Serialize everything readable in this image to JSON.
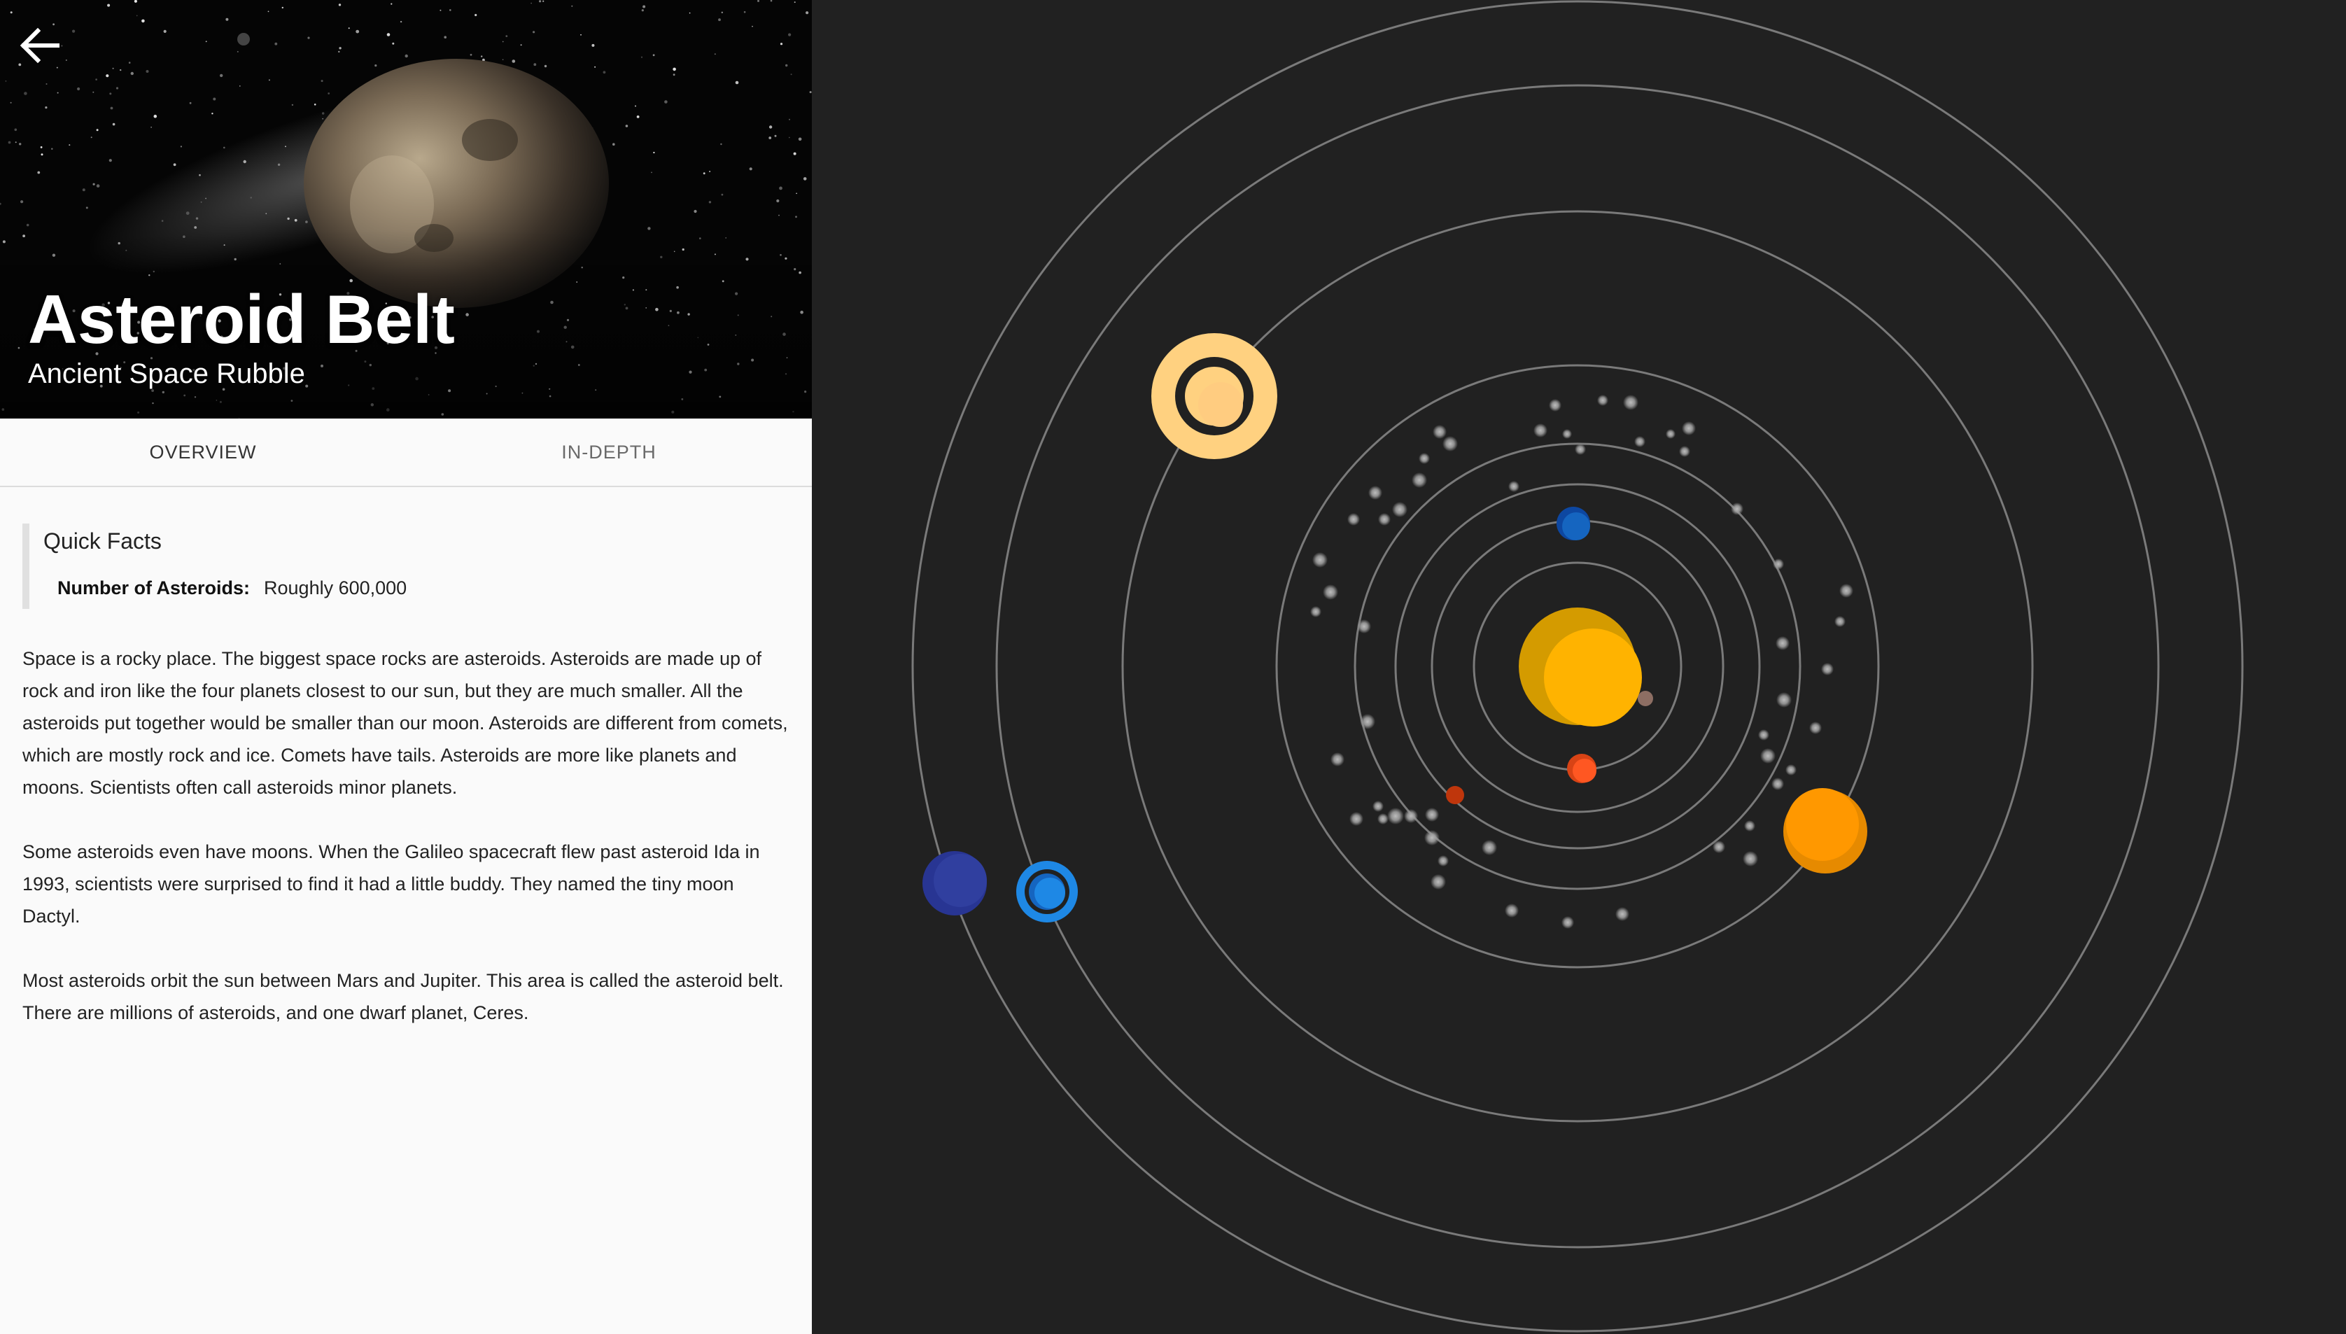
{
  "header": {
    "title": "Asteroid Belt",
    "subtitle": "Ancient Space Rubble",
    "back_icon": "arrow-left-icon"
  },
  "tabs": [
    {
      "label": "OVERVIEW",
      "selected": true
    },
    {
      "label": "IN-DEPTH",
      "selected": false
    }
  ],
  "quick_facts": {
    "title": "Quick Facts",
    "facts": [
      {
        "label": "Number of Asteroids:",
        "value": "Roughly 600,000"
      }
    ]
  },
  "paragraphs": [
    "Space is a rocky place. The biggest space rocks are asteroids. Asteroids are made up of rock and iron like the four planets closest to our sun, but they are much smaller. All the asteroids put together would be smaller than our moon. Asteroids are different from comets, which are mostly rock and ice. Comets have tails. Asteroids are more like planets and moons. Scientists often call asteroids minor planets.",
    "Some asteroids even have moons. When the Galileo spacecraft flew past asteroid Ida in 1993, scientists were surprised to find it had a little buddy. They named the tiny moon Dactyl.",
    "Most asteroids orbit the sun between Mars and Jupiter. This area is called the asteroid belt. There are millions of asteroids, and one dwarf planet, Ceres."
  ],
  "colors": {
    "background": "#212121",
    "orbit": "#7a7a7a",
    "sun": "#ffb300",
    "sun_shade": "#d49b00",
    "mercury": "#8d6e63",
    "venus": "#d84315",
    "earth": "#1565c0",
    "mars": "#ff5722",
    "jupiter": "#ff9800",
    "saturn": "#ffd180",
    "uranus": "#1e88e5",
    "neptune": "#303f9f",
    "asteroid": "#9e9e9e"
  }
}
